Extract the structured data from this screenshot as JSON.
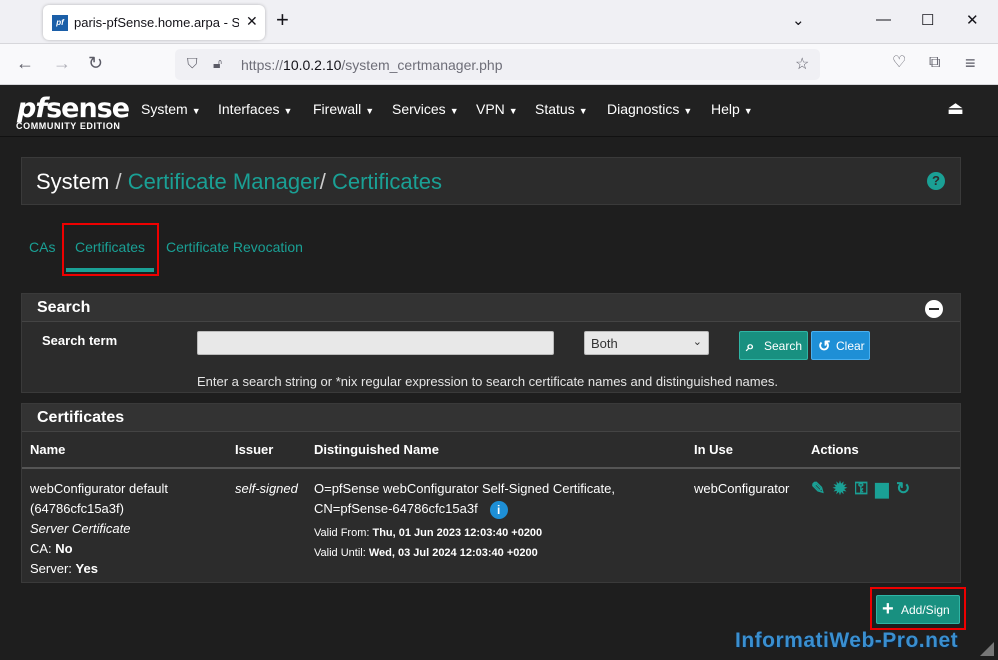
{
  "browser": {
    "tab_title": "paris-pfSense.home.arpa - System",
    "tab_favicon_text": "pf",
    "url_prefix": "https://",
    "url_host": "10.0.2.10",
    "url_path": "/system_certmanager.php"
  },
  "nav": {
    "logo_text": "sense",
    "logo_pf": "pf",
    "logo_sub": "COMMUNITY EDITION",
    "menu": [
      "System",
      "Interfaces",
      "Firewall",
      "Services",
      "VPN",
      "Status",
      "Diagnostics",
      "Help"
    ]
  },
  "breadcrumb": {
    "root": "System",
    "sep": "/",
    "section": "Certificate Manager",
    "page": "Certificates"
  },
  "tabs": [
    "CAs",
    "Certificates",
    "Certificate Revocation"
  ],
  "search": {
    "title": "Search",
    "label": "Search term",
    "value": "",
    "select_value": "Both",
    "search_btn": "Search",
    "clear_btn": "Clear",
    "help": "Enter a search string or *nix regular expression to search certificate names and distinguished names."
  },
  "certificates": {
    "title": "Certificates",
    "columns": [
      "Name",
      "Issuer",
      "Distinguished Name",
      "In Use",
      "Actions"
    ],
    "rows": [
      {
        "name": "webConfigurator default (64786cfc15a3f)",
        "type": "Server Certificate",
        "ca_label": "CA:",
        "ca_value": "No",
        "server_label": "Server:",
        "server_value": "Yes",
        "issuer": "self-signed",
        "dn_line1": "O=pfSense webConfigurator Self-Signed Certificate,",
        "dn_line2": "CN=pfSense-64786cfc15a3f",
        "valid_from_label": "Valid From:",
        "valid_from": "Thu, 01 Jun 2023 12:03:40 +0200",
        "valid_until_label": "Valid Until:",
        "valid_until": "Wed, 03 Jul 2024 12:03:40 +0200",
        "in_use": "webConfigurator"
      }
    ]
  },
  "add_button": "Add/Sign",
  "watermark": "InformatiWeb-Pro.net",
  "colors": {
    "accent": "#1aa095",
    "highlight": "#e00000"
  }
}
